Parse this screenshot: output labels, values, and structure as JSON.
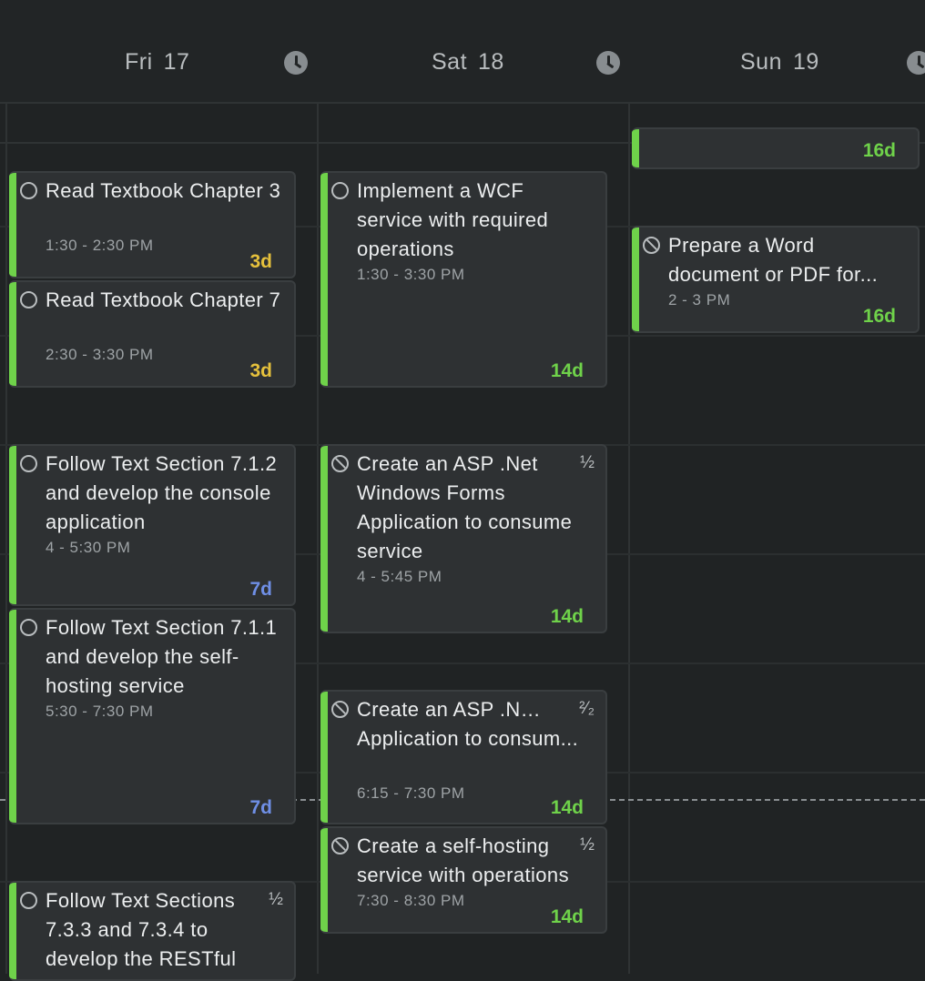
{
  "colors": {
    "accent_bar": "#6fd24a",
    "due_yellow": "#e6c13c",
    "due_blue": "#6f8fe6",
    "due_green": "#6fd24a"
  },
  "days": [
    {
      "name": "Fri",
      "num": "17"
    },
    {
      "name": "Sat",
      "num": "18"
    },
    {
      "name": "Sun",
      "num": "19"
    }
  ],
  "events": {
    "sun_top": {
      "due": "16d"
    },
    "fri_1": {
      "title": "Read Textbook Chapter 3",
      "time": "1:30 - 2:30 PM",
      "due": "3d",
      "icon": "circle-icon"
    },
    "fri_2": {
      "title": "Read Textbook Chapter 7",
      "time": "2:30 - 3:30 PM",
      "due": "3d",
      "icon": "circle-icon"
    },
    "fri_3": {
      "title": "Follow Text Section 7.1.2 and develop the console application",
      "time": "4 - 5:30 PM",
      "due": "7d",
      "icon": "circle-icon"
    },
    "fri_4": {
      "title": "Follow Text Section 7.1.1 and develop the self-hosting service",
      "time": "5:30 - 7:30 PM",
      "due": "7d",
      "icon": "circle-icon"
    },
    "fri_5": {
      "title": "Follow Text Sections 7.3.3 and 7.3.4 to develop the RESTful",
      "fraction": "½",
      "icon": "circle-icon"
    },
    "sat_1": {
      "title": "Implement a WCF service with required operations",
      "time": "1:30 - 3:30 PM",
      "due": "14d",
      "icon": "circle-icon"
    },
    "sat_2": {
      "title": "Create an ASP .Net Windows Forms Application to consume service",
      "time": "4 - 5:45 PM",
      "due": "14d",
      "fraction": "½",
      "icon": "blocked-icon"
    },
    "sat_3": {
      "title_line1": "Create an ASP .Net Windows Forms",
      "title_line2": "Application to consum...",
      "time": "6:15 - 7:30 PM",
      "due": "14d",
      "fraction": "²⁄₂",
      "icon": "blocked-icon"
    },
    "sat_4": {
      "title": "Create a self-hosting service with operations",
      "time": "7:30 - 8:30 PM",
      "due": "14d",
      "fraction": "½",
      "icon": "blocked-icon"
    },
    "sun_1": {
      "title_line1": "Prepare a Word",
      "title_line2": "document or PDF for...",
      "time": "2 - 3 PM",
      "due": "16d",
      "icon": "blocked-icon"
    }
  }
}
